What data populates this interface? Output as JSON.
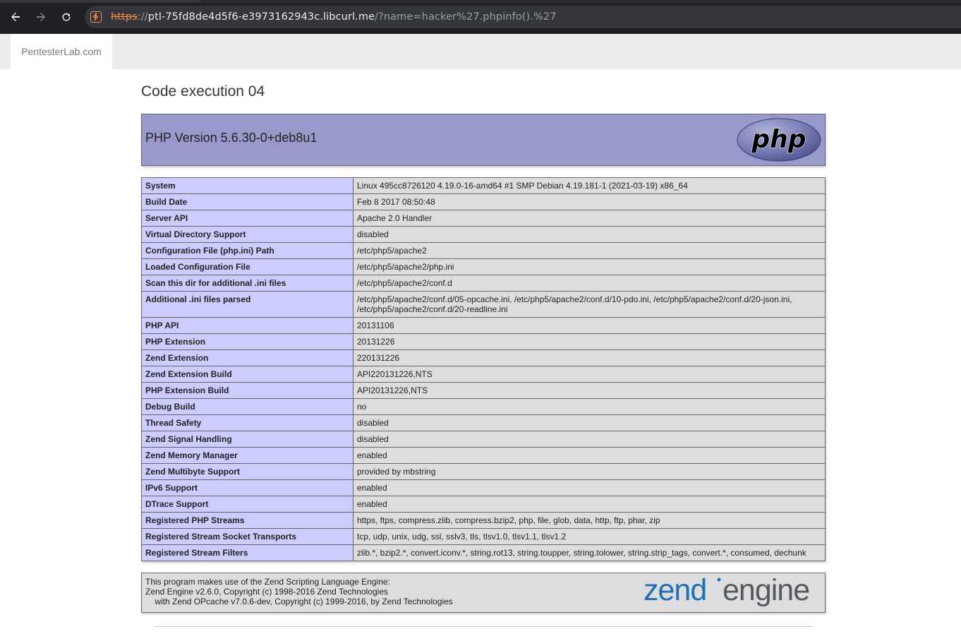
{
  "browser": {
    "url_scheme": "https",
    "url_sep": "://",
    "url_host": "ptl-75fd8de4d5f6-e3973162943c.libcurl.me",
    "url_path": "/?name=hacker%27.phpinfo().%27"
  },
  "site": {
    "brand": "PentesterLab.com"
  },
  "page": {
    "title": "Code execution 04"
  },
  "phpinfo": {
    "version_title": "PHP Version 5.6.30-0+deb8u1",
    "logo_text": "php",
    "rows": [
      {
        "label": "System",
        "value": "Linux 495cc8726120 4.19.0-16-amd64 #1 SMP Debian 4.19.181-1 (2021-03-19) x86_64"
      },
      {
        "label": "Build Date",
        "value": "Feb 8 2017 08:50:48"
      },
      {
        "label": "Server API",
        "value": "Apache 2.0 Handler"
      },
      {
        "label": "Virtual Directory Support",
        "value": "disabled"
      },
      {
        "label": "Configuration File (php.ini) Path",
        "value": "/etc/php5/apache2"
      },
      {
        "label": "Loaded Configuration File",
        "value": "/etc/php5/apache2/php.ini"
      },
      {
        "label": "Scan this dir for additional .ini files",
        "value": "/etc/php5/apache2/conf.d"
      },
      {
        "label": "Additional .ini files parsed",
        "value": "/etc/php5/apache2/conf.d/05-opcache.ini, /etc/php5/apache2/conf.d/10-pdo.ini, /etc/php5/apache2/conf.d/20-json.ini, /etc/php5/apache2/conf.d/20-readline.ini"
      },
      {
        "label": "PHP API",
        "value": "20131106"
      },
      {
        "label": "PHP Extension",
        "value": "20131226"
      },
      {
        "label": "Zend Extension",
        "value": "220131226"
      },
      {
        "label": "Zend Extension Build",
        "value": "API220131226,NTS"
      },
      {
        "label": "PHP Extension Build",
        "value": "API20131226,NTS"
      },
      {
        "label": "Debug Build",
        "value": "no"
      },
      {
        "label": "Thread Safety",
        "value": "disabled"
      },
      {
        "label": "Zend Signal Handling",
        "value": "disabled"
      },
      {
        "label": "Zend Memory Manager",
        "value": "enabled"
      },
      {
        "label": "Zend Multibyte Support",
        "value": "provided by mbstring"
      },
      {
        "label": "IPv6 Support",
        "value": "enabled"
      },
      {
        "label": "DTrace Support",
        "value": "enabled"
      },
      {
        "label": "Registered PHP Streams",
        "value": "https, ftps, compress.zlib, compress.bzip2, php, file, glob, data, http, ftp, phar, zip"
      },
      {
        "label": "Registered Stream Socket Transports",
        "value": "tcp, udp, unix, udg, ssl, sslv3, tls, tlsv1.0, tlsv1.1, tlsv1.2"
      },
      {
        "label": "Registered Stream Filters",
        "value": "zlib.*, bzip2.*, convert.iconv.*, string.rot13, string.toupper, string.tolower, string.strip_tags, convert.*, consumed, dechunk"
      }
    ],
    "zend_text": "This program makes use of the Zend Scripting Language Engine:\nZend Engine v2.6.0, Copyright (c) 1998-2016 Zend Technologies\n    with Zend OPcache v7.0.6-dev, Copyright (c) 1999-2016, by Zend Technologies",
    "zend_logo_left": "zend",
    "zend_logo_right": "engine"
  },
  "colors": {
    "header_bg": "#9999cc",
    "label_bg": "#ccccff",
    "value_bg": "#dddddd",
    "insecure_scheme": "#f28b54"
  },
  "icons": [
    "back-arrow-icon",
    "forward-arrow-icon",
    "reload-icon",
    "not-secure-icon"
  ]
}
